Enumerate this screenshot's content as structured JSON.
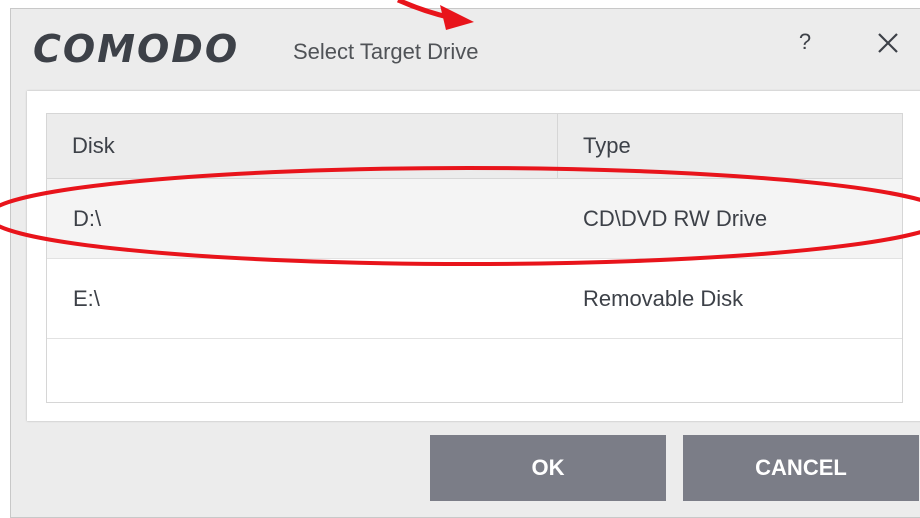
{
  "window": {
    "brand": "COMODO",
    "title": "Select Target Drive",
    "help_label": "?"
  },
  "table": {
    "columns": [
      "Disk",
      "Type"
    ],
    "rows": [
      {
        "disk": "D:\\",
        "type": "CD\\DVD RW Drive",
        "selected": true
      },
      {
        "disk": "E:\\",
        "type": "Removable Disk",
        "selected": false
      }
    ]
  },
  "buttons": {
    "ok": "OK",
    "cancel": "CANCEL"
  },
  "colors": {
    "button_bg": "#7b7d87",
    "annotation": "#e8141b",
    "header_bg": "#ececec"
  }
}
